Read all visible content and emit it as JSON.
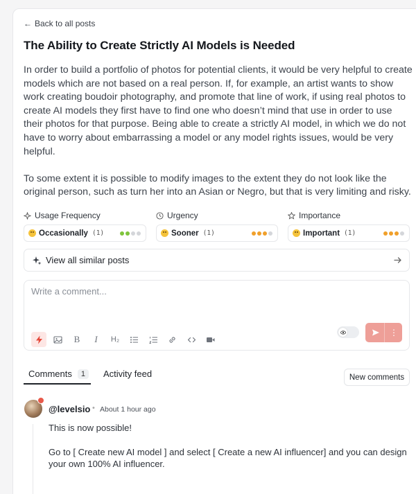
{
  "back_link": {
    "label": "Back to all posts"
  },
  "post": {
    "title": "The Ability to Create Strictly AI Models is Needed",
    "paragraphs": [
      "In order to build a portfolio of photos for potential clients, it would be very helpful to create models which are not based on a real person. If, for example, an artist wants to show work creating boudoir photography, and promote that line of work, if using real photos to create AI models they first have to find one who doesn’t mind that use in order to use their photos for that purpose. Being able to create a strictly AI model, in which we do not have to worry about embarrassing a model or any model rights issues, would be very helpful.",
      "To some extent it is possible to modify images to the extent they do not look like the original person, such as turn her into an Asian or Negro, but that is very limiting and risky."
    ]
  },
  "metrics": [
    {
      "label": "Usage Frequency",
      "icon": "sparkle-icon",
      "value": "Occasionally",
      "count": "(1)",
      "level": 2,
      "dot_color": "#7fc43c"
    },
    {
      "label": "Urgency",
      "icon": "clock-icon",
      "value": "Sooner",
      "count": "(1)",
      "level": 3,
      "dot_color": "#f0a02b"
    },
    {
      "label": "Importance",
      "icon": "star-icon",
      "value": "Important",
      "count": "(1)",
      "level": 3,
      "dot_color": "#f0a02b"
    }
  ],
  "similar": {
    "label": "View all similar posts"
  },
  "comment_box": {
    "placeholder": "Write a comment..."
  },
  "tabs": {
    "comments_label": "Comments",
    "comments_count": "1",
    "activity_label": "Activity feed"
  },
  "new_comments_label": "New comments",
  "comment": {
    "author": "@levelsio",
    "separator": "•",
    "time": "About 1 hour ago",
    "paragraphs": [
      "This is now possible!",
      "Go to [ Create new AI model ] and select [ Create a new AI influencer] and you can design your own 100% AI influencer."
    ]
  },
  "colors": {
    "accent": "#e5483a",
    "send_button": "#ee9f98",
    "dot_inactive": "#d4d6da"
  }
}
